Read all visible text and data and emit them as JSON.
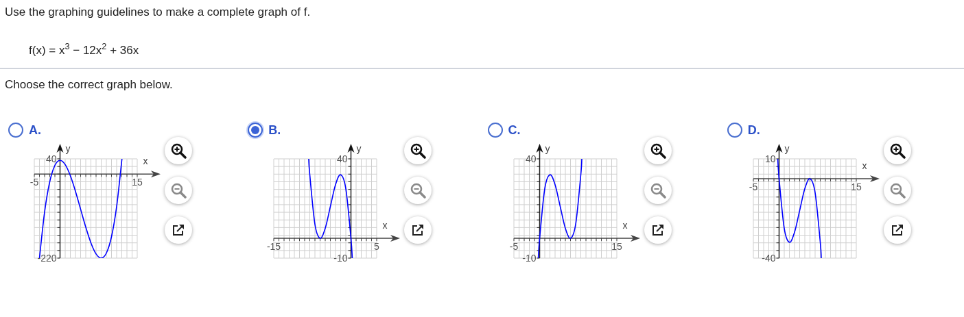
{
  "question": {
    "instruction": "Use the graphing guidelines to make a complete graph of f.",
    "formula": "f(x) = x$^{3}$ − 12x$^{2}$ + 36x",
    "prompt": "Choose the correct graph below."
  },
  "options": [
    {
      "label": "A.",
      "selected": false,
      "chart_data": {
        "type": "line",
        "xlabel": "x",
        "ylabel": "y",
        "x": [
          -4,
          -3,
          -2,
          -1,
          0,
          1,
          2,
          3,
          4,
          5,
          6,
          7,
          8,
          9,
          10,
          11,
          12,
          12.03
        ],
        "series": [
          {
            "color": "#0000ff",
            "values": [
              -220,
              -99,
              -20,
              23,
              36,
              25,
              -4,
              -45,
              -92,
              -139,
              -180,
              -209,
              -220,
              -207,
              -164,
              -85,
              36,
              40
            ]
          }
        ],
        "xlim": [
          -5,
          15
        ],
        "ylim": [
          -220,
          40
        ],
        "xticks": [
          -5,
          15
        ],
        "yticks": [
          -220,
          40
        ]
      }
    },
    {
      "label": "B.",
      "selected": true,
      "chart_data": {
        "type": "line",
        "xlabel": "x",
        "ylabel": "y",
        "x": [
          -8.21,
          -8,
          -7,
          -6,
          -5,
          -4,
          -3,
          -2,
          -1,
          0,
          0.26
        ],
        "series": [
          {
            "color": "#0000ff",
            "values": [
              40,
              32,
              7,
              0,
              5,
              16,
              27,
              32,
              25,
              0,
              -10
            ]
          }
        ],
        "xlim": [
          -15,
          5
        ],
        "ylim": [
          -10,
          40
        ],
        "xticks": [
          -15,
          5
        ],
        "yticks": [
          -10,
          40
        ]
      }
    },
    {
      "label": "C.",
      "selected": false,
      "chart_data": {
        "type": "line",
        "xlabel": "x",
        "ylabel": "y",
        "x": [
          -0.26,
          0,
          1,
          2,
          3,
          4,
          5,
          6,
          7,
          8,
          8.2
        ],
        "series": [
          {
            "color": "#0000ff",
            "values": [
              -10,
              0,
              25,
              32,
              27,
              16,
              5,
              0,
              7,
              32,
              40
            ]
          }
        ],
        "xlim": [
          -5,
          15
        ],
        "ylim": [
          -10,
          40
        ],
        "xticks": [
          -5,
          15
        ],
        "yticks": [
          -10,
          40
        ]
      }
    },
    {
      "label": "D.",
      "selected": false,
      "chart_data": {
        "type": "line",
        "xlabel": "x",
        "ylabel": "y",
        "x": [
          -0.26,
          0,
          1,
          2,
          3,
          4,
          5,
          6,
          7,
          8,
          8.2
        ],
        "series": [
          {
            "color": "#0000ff",
            "values": [
              10,
              0,
              -25,
              -32,
              -27,
              -16,
              -5,
              0,
              -7,
              -32,
              -40
            ]
          }
        ],
        "xlim": [
          -5,
          15
        ],
        "ylim": [
          -40,
          10
        ],
        "xticks": [
          -5,
          15
        ],
        "yticks": [
          -40,
          10
        ]
      }
    }
  ]
}
